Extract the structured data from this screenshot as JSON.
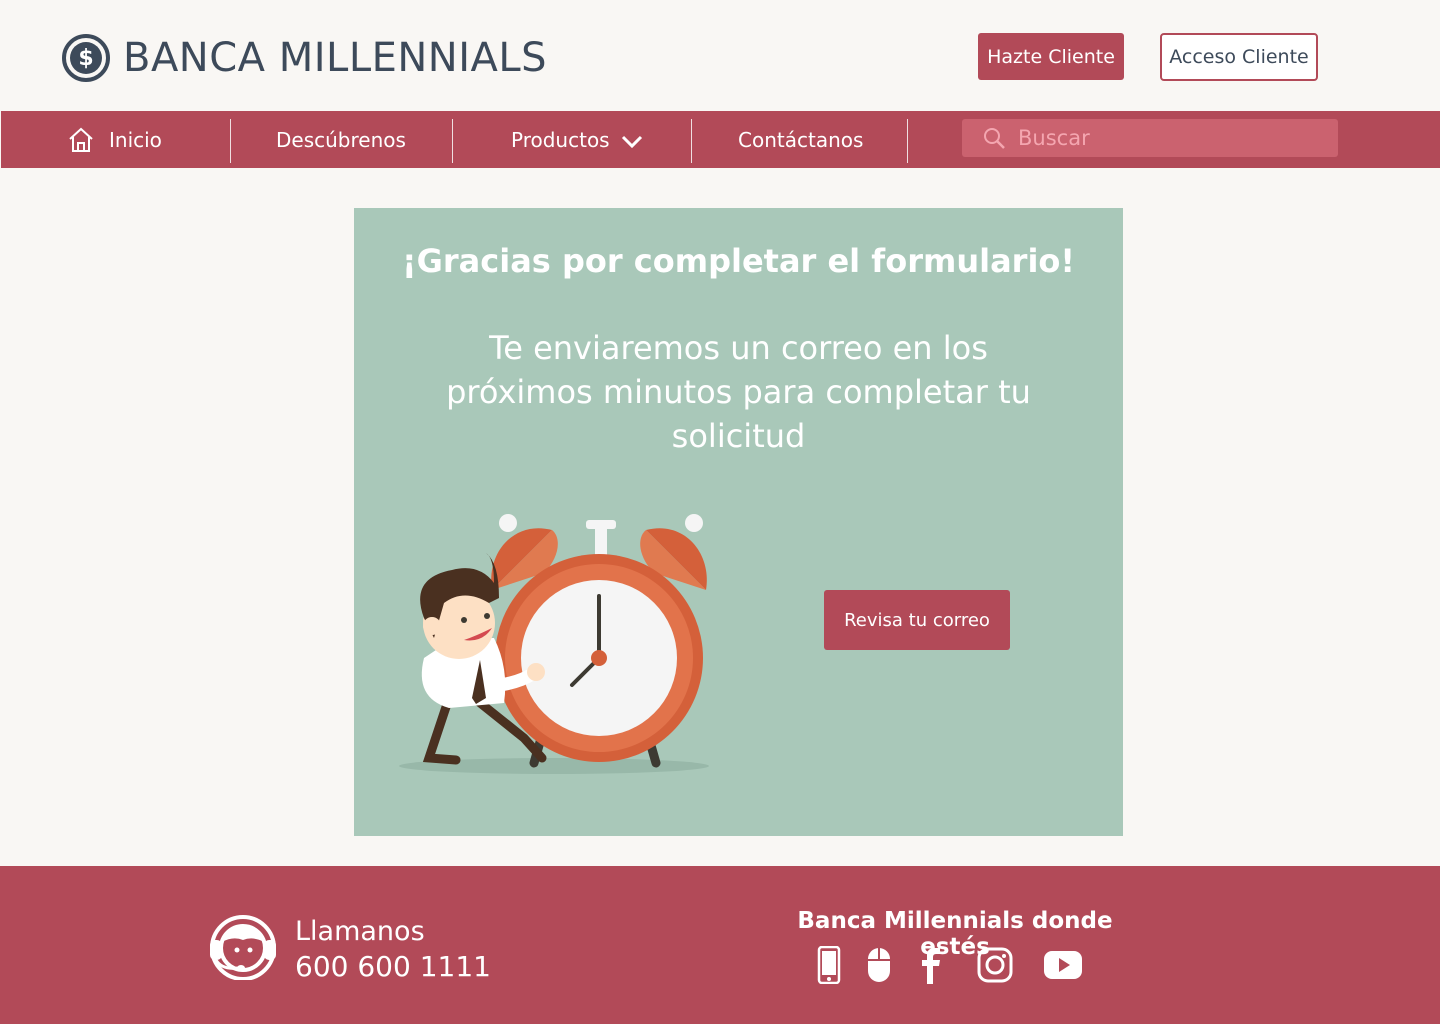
{
  "brand": {
    "name": "BANCA MILLENNIALS"
  },
  "header": {
    "signup_label": "Hazte Cliente",
    "login_label": "Acceso Cliente"
  },
  "nav": {
    "items": [
      {
        "label": "Inicio",
        "icon": "home-icon"
      },
      {
        "label": "Descúbrenos"
      },
      {
        "label": "Productos",
        "icon": "chevron-down-icon"
      },
      {
        "label": "Contáctanos"
      }
    ],
    "search_placeholder": "Buscar"
  },
  "main": {
    "title": "¡Gracias por completar el formulario!",
    "subtitle": "Te enviaremos un correo en los próximos minutos para completar tu solicitud",
    "cta_label": "Revisa tu correo",
    "illustration": "man-with-alarm-clock"
  },
  "footer": {
    "call_label": "Llamanos",
    "call_number": "600 600 1111",
    "social_title": "Banca Millennials donde estés",
    "social_icons": [
      "mobile-phone-icon",
      "mouse-icon",
      "facebook-icon",
      "instagram-icon",
      "youtube-icon"
    ]
  },
  "colors": {
    "brand": "#b24a58",
    "card": "#a9c8b9",
    "background": "#f9f7f4",
    "text": "#3d4a5a",
    "search_bg": "#cb626f"
  }
}
